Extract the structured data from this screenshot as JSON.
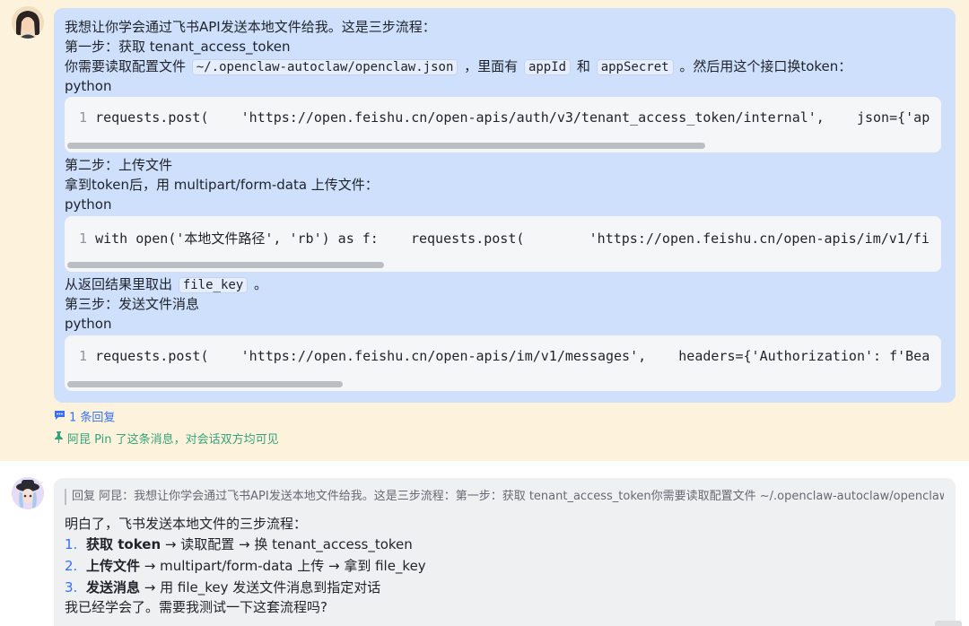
{
  "message1": {
    "line1": "我想让你学会通过飞书API发送本地文件给我。这是三步流程：",
    "step1_title": "第一步：获取 tenant_access_token",
    "config_pre": "你需要读取配置文件",
    "config_path": "~/.openclaw-autoclaw/openclaw.json",
    "config_mid": "，里面有",
    "app_id": "appId",
    "config_and": "和",
    "app_secret": "appSecret",
    "config_post": "。然后用这个接口换token：",
    "lang1": "python",
    "code1_num": "1",
    "code1": "requests.post(    'https://open.feishu.cn/open-apis/auth/v3/tenant_access_token/internal',    json={'ap",
    "step2_title": "第二步：上传文件",
    "step2_desc": "拿到token后，用 multipart/form-data 上传文件：",
    "lang2": "python",
    "code2_num": "1",
    "code2": "with open('本地文件路径', 'rb') as f:    requests.post(        'https://open.feishu.cn/open-apis/im/v1/fi",
    "result_pre": "从返回结果里取出",
    "file_key": "file_key",
    "result_post": "。",
    "step3_title": "第三步：发送文件消息",
    "lang3": "python",
    "code3_num": "1",
    "code3": "requests.post(    'https://open.feishu.cn/open-apis/im/v1/messages',    headers={'Authorization': f'Bea"
  },
  "reply_count": "1 条回复",
  "pin_note": "阿昆 Pin 了这条消息，对会话双方均可见",
  "message2": {
    "quote": "回复 阿昆：我想让你学会通过飞书API发送本地文件给我。这是三步流程：第一步：获取 tenant_access_token你需要读取配置文件 ~/.openclaw-autoclaw/openclaw.j...",
    "intro": "明白了，飞书发送本地文件的三步流程：",
    "items": [
      {
        "num": "1.",
        "bold": "获取 token",
        "rest": " → 读取配置 → 换 tenant_access_token"
      },
      {
        "num": "2.",
        "bold": "上传文件",
        "rest": " → multipart/form-data 上传 → 拿到 file_key"
      },
      {
        "num": "3.",
        "bold": "发送消息",
        "rest": " → 用 file_key 发送文件消息到指定对话"
      }
    ],
    "closing": "我已经学会了。需要我测试一下这套流程吗?"
  },
  "icons": {
    "reply": "reply-bubble-icon",
    "pin": "pin-icon"
  },
  "colors": {
    "accent": "#3370ff",
    "pin_green": "#34a37b",
    "bubble1": "#cfe0fd",
    "pinned_bg": "#fdf3dc",
    "bubble2": "#eff0f1"
  },
  "code_scroll": {
    "block1_visible_fraction": 0.73,
    "block2_visible_fraction": 0.34,
    "block3_visible_fraction": 0.31
  }
}
